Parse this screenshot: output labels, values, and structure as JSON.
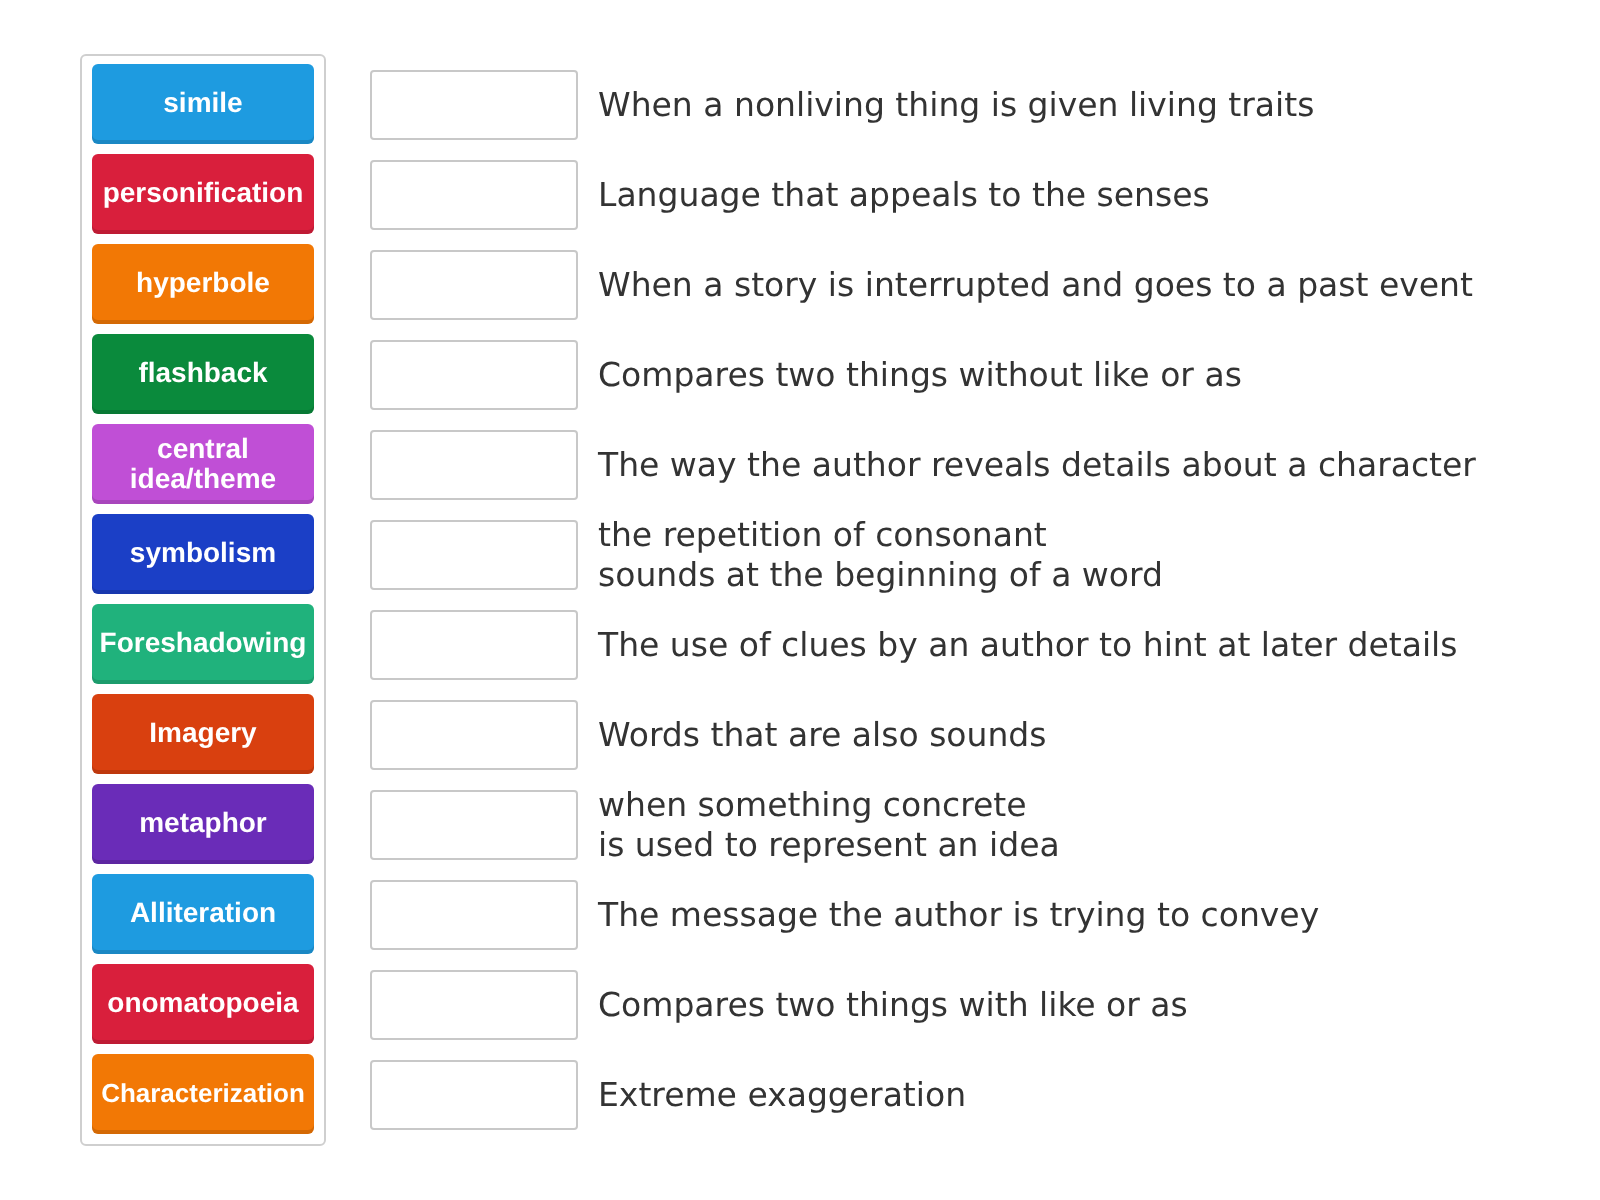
{
  "tiles": [
    {
      "label": "simile",
      "color": "#1e9be0"
    },
    {
      "label": "personification",
      "color": "#d91f3c"
    },
    {
      "label": "hyperbole",
      "color": "#f27805"
    },
    {
      "label": "flashback",
      "color": "#0a8a3c"
    },
    {
      "label": "central idea/theme",
      "color": "#c04fd6"
    },
    {
      "label": "symbolism",
      "color": "#1b3fc6"
    },
    {
      "label": "Foreshadowing",
      "color": "#20b27c"
    },
    {
      "label": "Imagery",
      "color": "#d9400f"
    },
    {
      "label": "metaphor",
      "color": "#6a2cb8"
    },
    {
      "label": "Alliteration",
      "color": "#1e9be0"
    },
    {
      "label": "onomatopoeia",
      "color": "#d91f3c"
    },
    {
      "label": "Characterization",
      "color": "#f27805"
    }
  ],
  "rows": [
    {
      "definition": "When a nonliving thing is given living traits"
    },
    {
      "definition": "Language that appeals to the senses"
    },
    {
      "definition": "When a story is interrupted and goes to a past event"
    },
    {
      "definition": "Compares two things without like or as"
    },
    {
      "definition": "The way the author reveals details about a character"
    },
    {
      "definition": "the repetition of consonant\nsounds at the beginning of a word"
    },
    {
      "definition": "The use of clues by an author to hint at later details"
    },
    {
      "definition": "Words that are also sounds"
    },
    {
      "definition": "when something concrete\nis used to represent an idea"
    },
    {
      "definition": "The message the author is trying to convey"
    },
    {
      "definition": "Compares two things with like or as"
    },
    {
      "definition": "Extreme exaggeration"
    }
  ]
}
